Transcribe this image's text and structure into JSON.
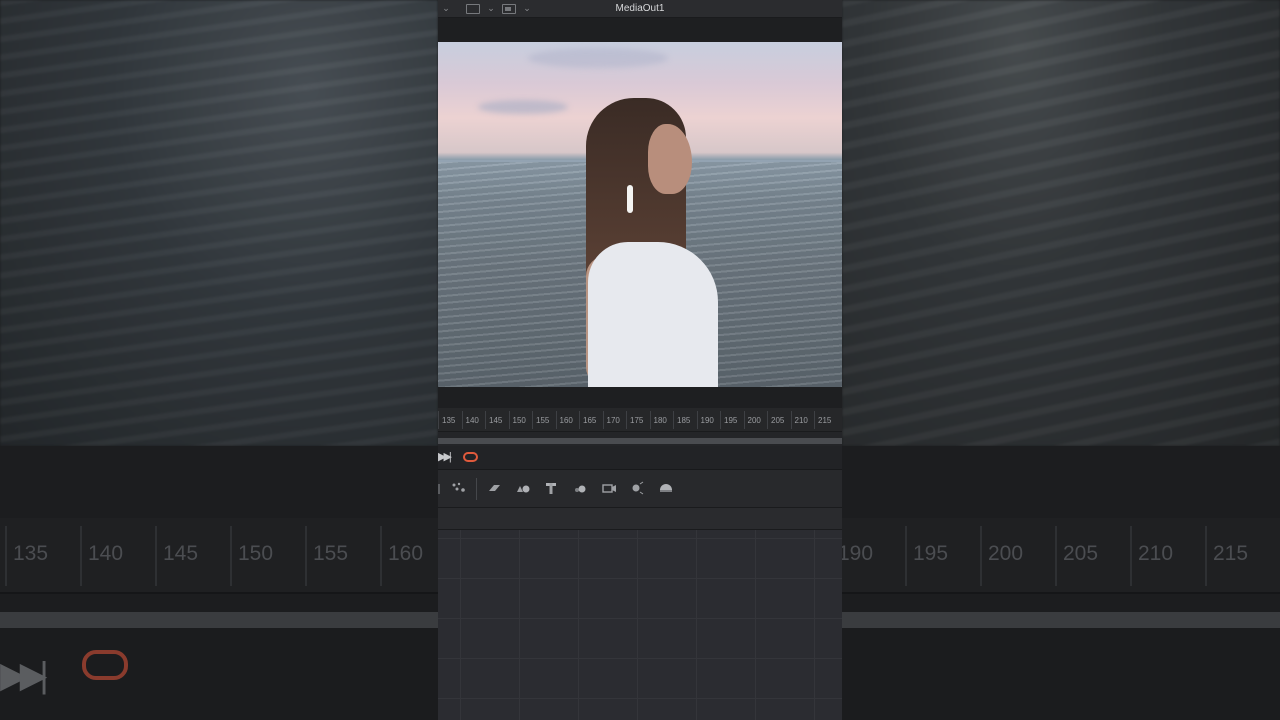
{
  "viewer": {
    "title": "MediaOut1"
  },
  "ruler": {
    "ticks": [
      "135",
      "140",
      "145",
      "150",
      "155",
      "160",
      "165",
      "170",
      "175",
      "180",
      "185",
      "190",
      "195",
      "200",
      "205",
      "210",
      "215"
    ]
  },
  "background_ruler": {
    "ticks_left": [
      "135",
      "140",
      "145",
      "150",
      "155",
      "160"
    ],
    "ticks_right": [
      "190",
      "195",
      "200",
      "205",
      "210",
      "215"
    ]
  },
  "icons": {
    "topbar": [
      "chevron-down-icon",
      "viewer-mode-icon",
      "chevron-down-icon",
      "window-icon",
      "chevron-down-icon"
    ],
    "transport": [
      "skip-to-end-icon",
      "loop-icon"
    ],
    "toolbar": [
      "particles-icon",
      "image-plane-icon",
      "shape-3d-icon",
      "text-3d-icon",
      "merge-3d-icon",
      "camera-3d-icon",
      "light-icon",
      "renderer-icon"
    ]
  },
  "colors": {
    "accent_loop": "#e05a3c",
    "panel": "#242528",
    "grid": "#2b2c31"
  }
}
